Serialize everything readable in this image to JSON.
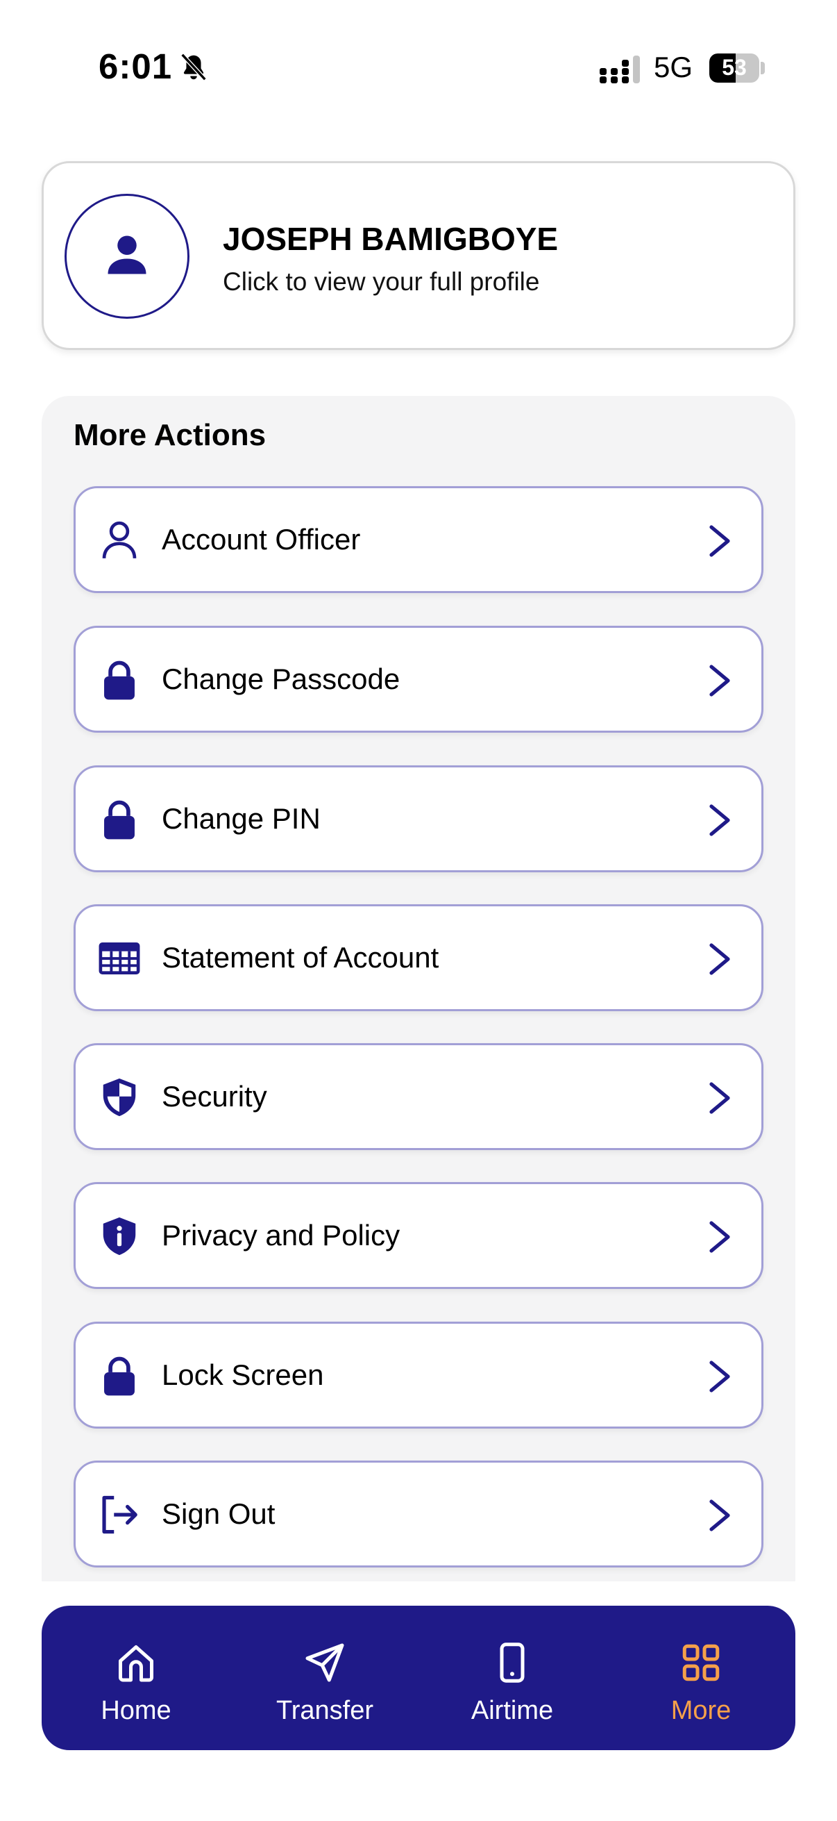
{
  "status_bar": {
    "time": "6:01",
    "network": "5G",
    "battery_level": "53",
    "battery_fraction": 0.53
  },
  "profile": {
    "name": "JOSEPH BAMIGBOYE",
    "subtitle": "Click to view your full profile",
    "icon": "person-icon"
  },
  "actions": {
    "title": "More Actions",
    "items": [
      {
        "label": "Account Officer",
        "icon": "person-outline-icon"
      },
      {
        "label": "Change Passcode",
        "icon": "lock-icon"
      },
      {
        "label": "Change PIN",
        "icon": "lock-icon"
      },
      {
        "label": "Statement of Account",
        "icon": "table-icon"
      },
      {
        "label": "Security",
        "icon": "shield-icon"
      },
      {
        "label": "Privacy and Policy",
        "icon": "shield-info-icon"
      },
      {
        "label": "Lock Screen",
        "icon": "lock-icon"
      },
      {
        "label": "Sign Out",
        "icon": "sign-out-icon"
      }
    ]
  },
  "nav": {
    "items": [
      {
        "label": "Home",
        "icon": "home-icon",
        "active": false
      },
      {
        "label": "Transfer",
        "icon": "send-icon",
        "active": false
      },
      {
        "label": "Airtime",
        "icon": "phone-icon",
        "active": false
      },
      {
        "label": "More",
        "icon": "grid-icon",
        "active": true
      }
    ]
  },
  "colors": {
    "brand": "#1f1a88",
    "accent": "#f5a04a",
    "card_border": "#a29fd6",
    "panel_bg": "#f4f4f5"
  }
}
